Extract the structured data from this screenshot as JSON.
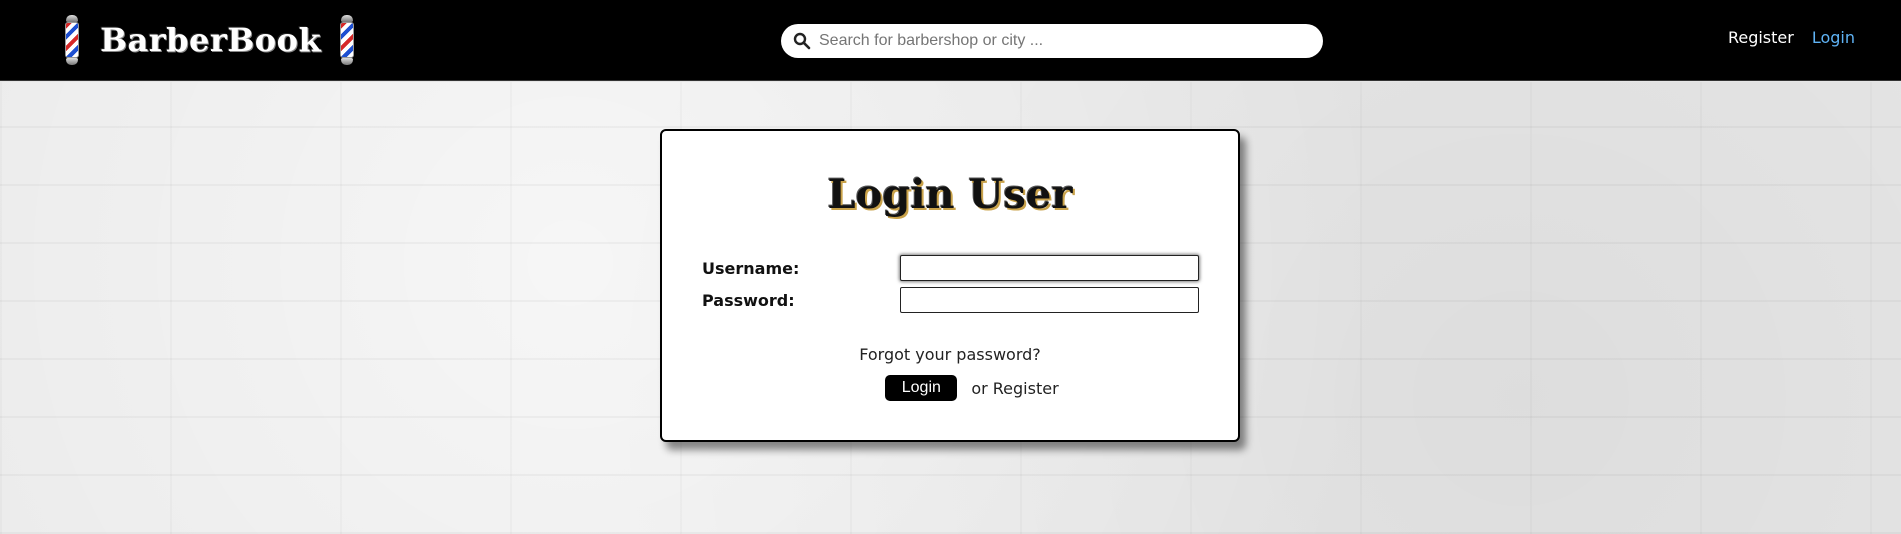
{
  "navbar": {
    "brand": "BarberBook",
    "search": {
      "placeholder": "Search for barbershop or city ...",
      "value": ""
    },
    "links": {
      "register": "Register",
      "login": "Login"
    }
  },
  "login_card": {
    "title": "Login User",
    "username_label": "Username:",
    "password_label": "Password:",
    "forgot_link": "Forgot your password?",
    "login_button": "Login",
    "or_register": "or Register"
  },
  "colors": {
    "navbar_bg": "#000000",
    "nav_login_link": "#5fb3f5",
    "button_bg": "#000000"
  }
}
